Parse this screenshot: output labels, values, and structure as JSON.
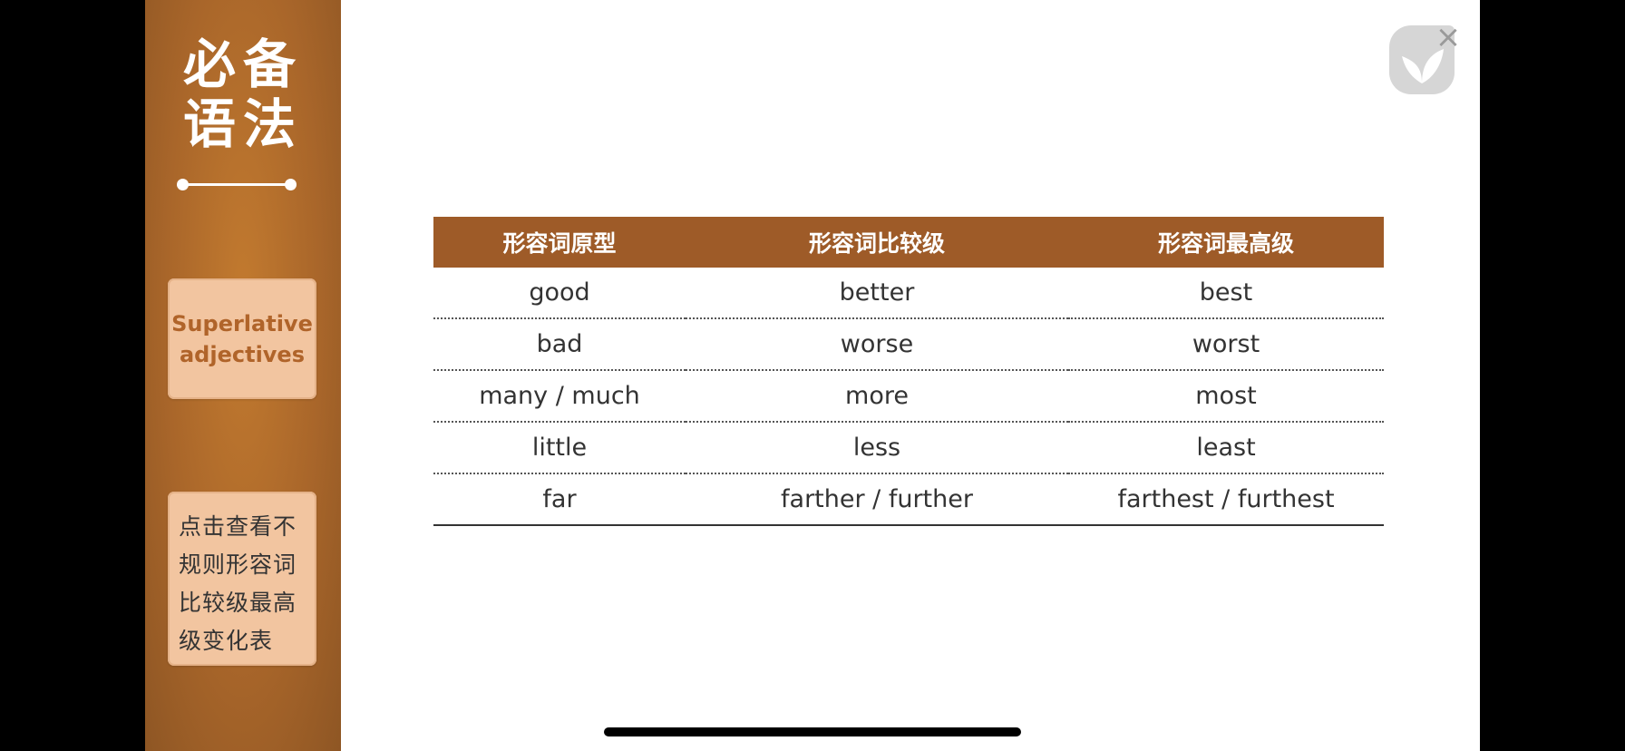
{
  "sidebar": {
    "title_line1": "必备",
    "title_line2": "语法",
    "superlative_button": {
      "line1": "Superlative",
      "line2": "adjectives"
    },
    "irregular_button_label": "点击查看不规则形容词比较级最高级变化表"
  },
  "table": {
    "headers": [
      "形容词原型",
      "形容词比较级",
      "形容词最高级"
    ],
    "rows": [
      [
        "good",
        "better",
        "best"
      ],
      [
        "bad",
        "worse",
        "worst"
      ],
      [
        "many / much",
        "more",
        "most"
      ],
      [
        "little",
        "less",
        "least"
      ],
      [
        "far",
        "farther / further",
        "farthest / furthest"
      ]
    ]
  },
  "icons": {
    "logo": "leaf-logo-icon",
    "close": "close-icon"
  },
  "colors": {
    "sidebar": "#a9662a",
    "table_header": "#9e5b28",
    "button_bg": "#f2c5a0",
    "button_text": "#b0642a"
  }
}
